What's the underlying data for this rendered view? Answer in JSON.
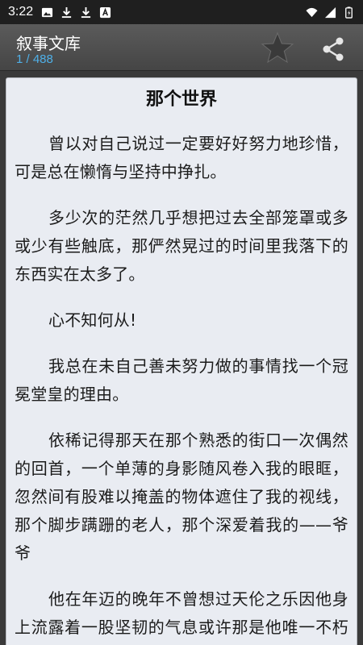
{
  "status_bar": {
    "time": "3:22",
    "left_icons": [
      "image-icon",
      "download-icon",
      "download-icon",
      "text-a-icon"
    ],
    "right_icons": [
      "wifi-icon",
      "signal-icon",
      "battery-icon"
    ]
  },
  "app_bar": {
    "title": "叙事文库",
    "page_indicator": "1 / 488",
    "star_icon": "star-icon",
    "share_icon": "share-icon"
  },
  "content": {
    "chapter_title": "那个世界",
    "paragraphs": [
      "曾以对自己说过一定要好好努力地珍惜，可是总在懒惰与坚持中挣扎。",
      "多少次的茫然几乎想把过去全部笼罩或多或少有些触底，那俨然晃过的时间里我落下的东西实在太多了。",
      "心不知何从!",
      "我总在未自己善未努力做的事情找一个冠冕堂皇的理由。",
      "依稀记得那天在那个熟悉的街口一次偶然的回首，一个单薄的身影随风卷入我的眼眶，忽然间有股难以掩盖的物体遮住了我的视线，那个脚步蹒跚的老人，那个深爱着我的——爷爷",
      "他在年迈的晚年不曾想过天伦之乐因他身上流露着一股坚韧的气息或许那是他唯一不朽的灵魂，因他的那股韧劲他那瘦弱的躯"
    ]
  },
  "colors": {
    "status_bar": "#1f1f1f",
    "app_bar": "#4e4e4e",
    "page_indicator": "#4fb0e8",
    "page_background": "#e9ecf2"
  }
}
